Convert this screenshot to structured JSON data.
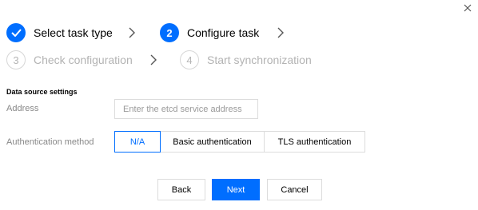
{
  "dialog": {
    "close_icon": "close-icon"
  },
  "steps": [
    {
      "number": "1",
      "label": "Select task type",
      "status": "completed"
    },
    {
      "number": "2",
      "label": "Configure task",
      "status": "active"
    },
    {
      "number": "3",
      "label": "Check configuration",
      "status": "pending"
    },
    {
      "number": "4",
      "label": "Start synchronization",
      "status": "pending"
    }
  ],
  "section": {
    "title": "Data source settings"
  },
  "address": {
    "label": "Address",
    "placeholder": "Enter the etcd service address",
    "value": ""
  },
  "auth": {
    "label": "Authentication method",
    "options": [
      "N/A",
      "Basic authentication",
      "TLS authentication"
    ],
    "selected": "N/A"
  },
  "actions": {
    "back": "Back",
    "next": "Next",
    "cancel": "Cancel"
  },
  "colors": {
    "accent": "#006eff",
    "muted_text": "#b3b3b3",
    "label_text": "#888888"
  }
}
